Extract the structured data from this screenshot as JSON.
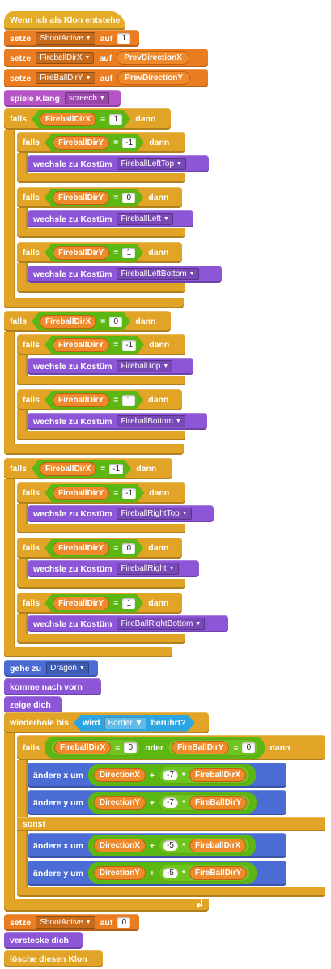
{
  "hat": "Wenn ich als Klon entstehe",
  "set_label": "setze",
  "to_label": "auf",
  "if_label": "falls",
  "then_label": "dann",
  "else_label": "sonst",
  "or_label": "oder",
  "eq": "=",
  "plus": "+",
  "times": "*",
  "switch_costume_label": "wechsle zu Kostüm",
  "change_x_label": "ändere x um",
  "change_y_label": "ändere y um",
  "vars": {
    "shoot": "ShootActive",
    "fdx": "FireballDirX",
    "fdy": "FireBallDirY",
    "fdx_r": "FireballDirX",
    "fdy_r": "FireballDirY",
    "fdy_r2": "FireBallDirY",
    "pdx": "PrevDirectionX",
    "pdy": "PrevDirectionY",
    "dirx": "DirectionX",
    "diry": "DirectionY"
  },
  "values": {
    "one": "1",
    "zero": "0",
    "minus_one": "-1",
    "minus_seven": "-7",
    "minus_five": "-5"
  },
  "sound": {
    "label": "spiele Klang",
    "name": "screech"
  },
  "costumes": {
    "lt": "FireballLeftTop",
    "l": "FireballLeft",
    "lb": "FireballLeftBottom",
    "t": "FireballTop",
    "b": "FireballBottom",
    "rt": "FireballRightTop",
    "r": "FireballRight",
    "rb": "FireBallRightBottom"
  },
  "goto": {
    "label": "gehe zu",
    "target": "Dragon"
  },
  "front": "komme nach vorn",
  "show": "zeige dich",
  "repeat_until": "wiederhole bis",
  "touching": {
    "prefix": "wird",
    "target": "Border",
    "suffix": "berührt?"
  },
  "hide": "verstecke dich",
  "delete_clone": "lösche diesen Klon",
  "loop_arrow": "↲"
}
